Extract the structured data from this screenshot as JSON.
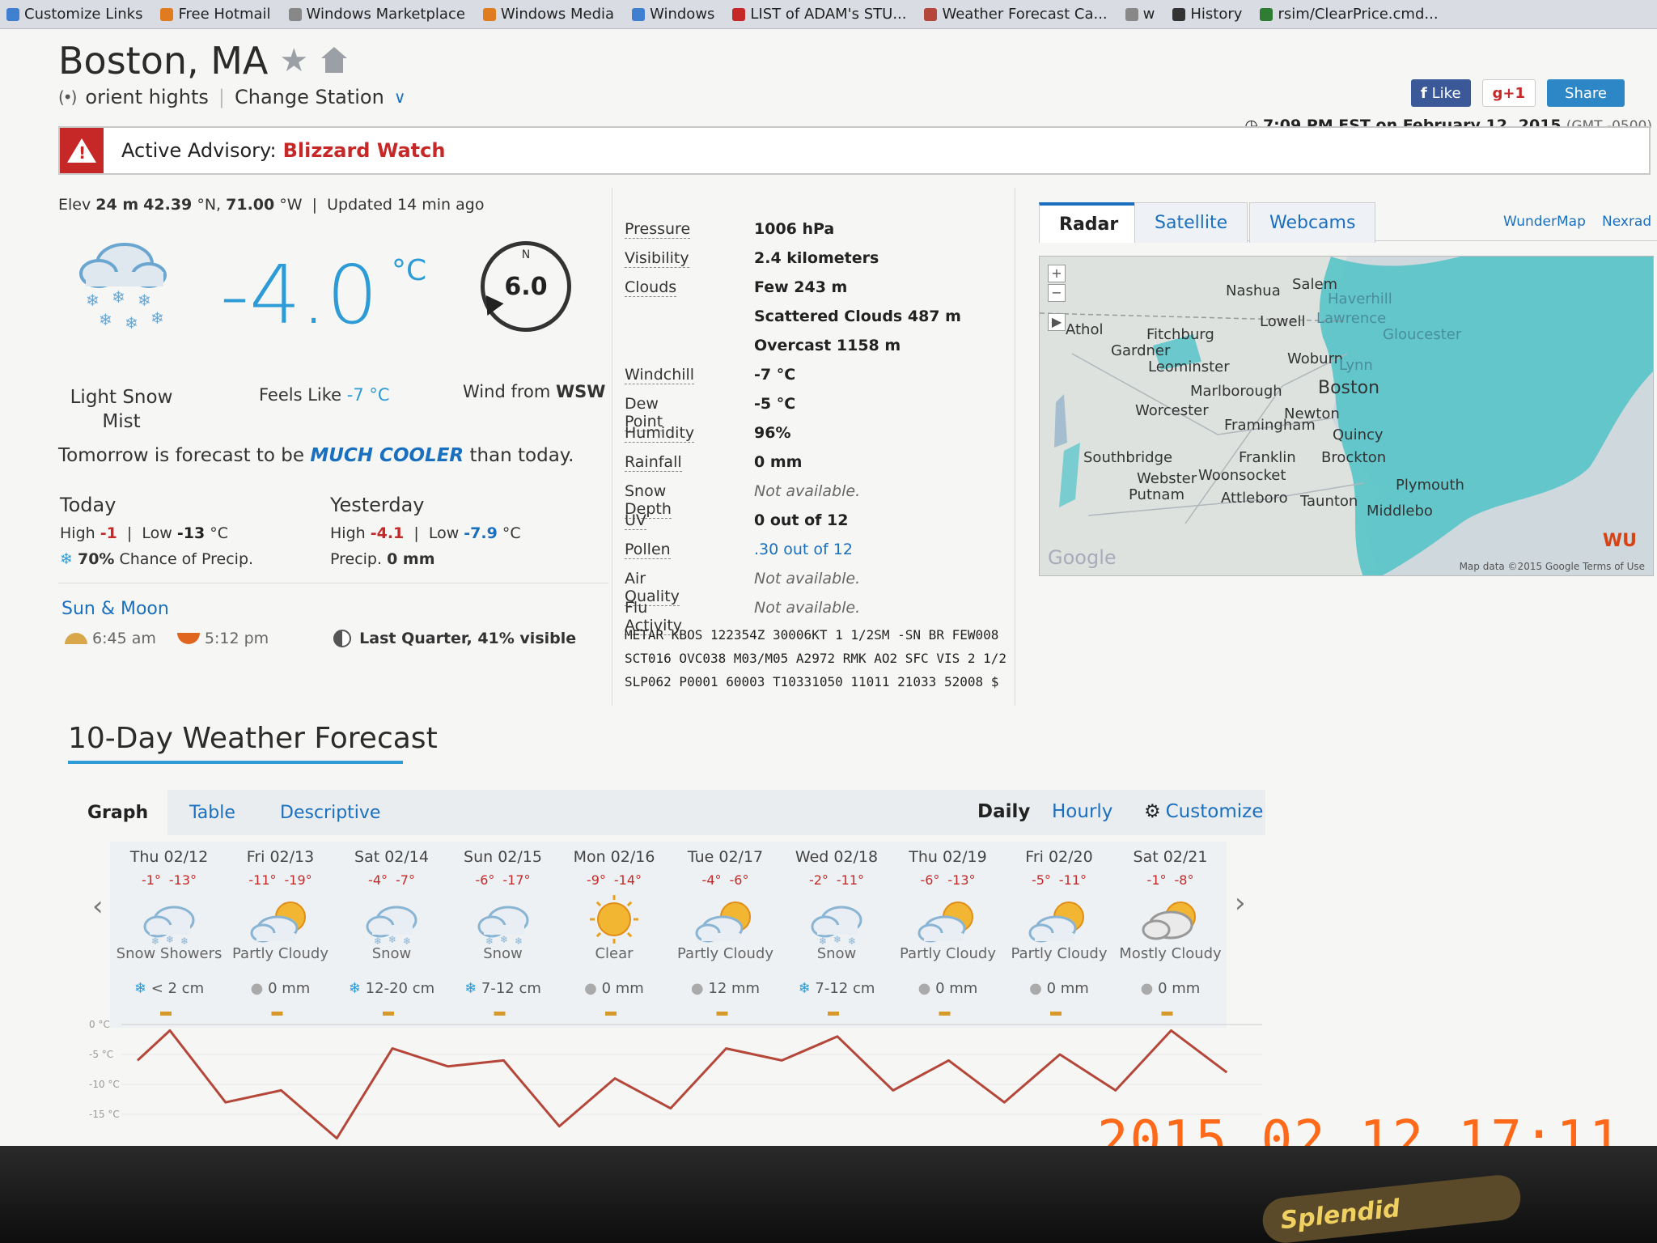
{
  "bookmarks": [
    "Customize Links",
    "Free Hotmail",
    "Windows Marketplace",
    "Windows Media",
    "Windows",
    "LIST of ADAM's STU...",
    "Weather Forecast Ca...",
    "w",
    "History",
    "rsim/ClearPrice.cmd..."
  ],
  "header": {
    "city": "Boston, MA",
    "station": "orient hights",
    "change_station": "Change Station",
    "like": "Like",
    "gplus": "g+1",
    "share": "Share",
    "time": "7:09 PM EST on February 12, 2015",
    "gmt": "(GMT -0500)"
  },
  "advisory": {
    "label": "Active Advisory:",
    "type": "Blizzard Watch"
  },
  "current": {
    "elev_prefix": "Elev",
    "elev": "24 m",
    "lat": "42.39",
    "lon": "71.00",
    "updated": "Updated 14 min ago",
    "temp": "-4.0",
    "unit": "°C",
    "wind_speed": "6.0",
    "wind_n": "N",
    "condition1": "Light Snow",
    "condition2": "Mist",
    "feels_label": "Feels Like",
    "feels": "-7 °C",
    "wind_from_label": "Wind from",
    "wind_dir": "WSW",
    "tomorrow_pre": "Tomorrow is forecast to be",
    "tomorrow_em": "MUCH COOLER",
    "tomorrow_post": "than today."
  },
  "today": {
    "label": "Today",
    "high": "-1",
    "low": "-13",
    "unit": "°C",
    "precip_chance": "70%",
    "precip_text": "Chance of Precip."
  },
  "yesterday": {
    "label": "Yesterday",
    "high": "-4.1",
    "low": "-7.9",
    "unit": "°C",
    "precip_label": "Precip.",
    "precip": "0 mm"
  },
  "sunmoon": {
    "title": "Sun & Moon",
    "sunrise": "6:45 am",
    "sunset": "5:12 pm",
    "phase": "Last Quarter, 41% visible"
  },
  "details": [
    {
      "label": "Pressure",
      "value": "1006 hPa"
    },
    {
      "label": "Visibility",
      "value": "2.4 kilometers"
    },
    {
      "label": "Clouds",
      "value": "Few 243 m"
    },
    {
      "label": "",
      "value": "Scattered Clouds 487 m"
    },
    {
      "label": "",
      "value": "Overcast 1158 m"
    },
    {
      "label": "Windchill",
      "value": "-7 °C"
    },
    {
      "label": "Dew Point",
      "value": "-5 °C"
    },
    {
      "label": "Humidity",
      "value": "96%"
    },
    {
      "label": "Rainfall",
      "value": "0 mm"
    },
    {
      "label": "Snow Depth",
      "value": "Not available."
    },
    {
      "label": "UV",
      "value": "0 out of 12"
    },
    {
      "label": "Pollen",
      "value": ".30 out of 12"
    },
    {
      "label": "Air Quality",
      "value": "Not available."
    },
    {
      "label": "Flu Activity",
      "value": "Not available."
    }
  ],
  "metar": "METAR KBOS 122354Z 30006KT 1 1/2SM -SN BR FEW008 SCT016 OVC038 M03/M05 A2972 RMK AO2 SFC VIS 2 1/2 SLP062 P0001 60003 T10331050 11011 21033 52008 $",
  "map": {
    "tabs": [
      "Radar",
      "Satellite",
      "Webcams"
    ],
    "links": [
      "WunderMap",
      "Nexrad"
    ],
    "cities": [
      "Nashua",
      "Salem",
      "Haverhill",
      "Lawrence",
      "Lowell",
      "Gloucester",
      "Athol",
      "Fitchburg",
      "Gardner",
      "Leominster",
      "Woburn",
      "Lynn",
      "Marlborough",
      "Boston",
      "Worcester",
      "Newton",
      "Framingham",
      "Quincy",
      "Southbridge",
      "Franklin",
      "Brockton",
      "Webster",
      "Woonsocket",
      "Putnam",
      "Attleboro",
      "Taunton",
      "Plymouth",
      "Middlebo"
    ],
    "attrib": "Map data ©2015 Google    Terms of Use",
    "google": "Google",
    "logo": "WU"
  },
  "forecast": {
    "title": "10-Day Weather Forecast",
    "tabs": [
      "Graph",
      "Table",
      "Descriptive"
    ],
    "views": [
      "Daily",
      "Hourly",
      "Customize"
    ],
    "days": [
      {
        "date": "Thu 02/12",
        "hi": "-1°",
        "lo": "-13°",
        "cond": "Snow Showers",
        "precip": "< 2 cm",
        "icon": "snow-icon",
        "snow": true
      },
      {
        "date": "Fri 02/13",
        "hi": "-11°",
        "lo": "-19°",
        "cond": "Partly Cloudy",
        "precip": "0 mm",
        "icon": "partly-cloudy-icon",
        "snow": false
      },
      {
        "date": "Sat 02/14",
        "hi": "-4°",
        "lo": "-7°",
        "cond": "Snow",
        "precip": "12-20 cm",
        "icon": "snow-icon",
        "snow": true
      },
      {
        "date": "Sun 02/15",
        "hi": "-6°",
        "lo": "-17°",
        "cond": "Snow",
        "precip": "7-12 cm",
        "icon": "snow-icon",
        "snow": true
      },
      {
        "date": "Mon 02/16",
        "hi": "-9°",
        "lo": "-14°",
        "cond": "Clear",
        "precip": "0 mm",
        "icon": "sun-icon",
        "snow": false
      },
      {
        "date": "Tue 02/17",
        "hi": "-4°",
        "lo": "-6°",
        "cond": "Partly Cloudy",
        "precip": "12 mm",
        "icon": "partly-cloudy-icon",
        "snow": false
      },
      {
        "date": "Wed 02/18",
        "hi": "-2°",
        "lo": "-11°",
        "cond": "Snow",
        "precip": "7-12 cm",
        "icon": "snow-icon",
        "snow": true
      },
      {
        "date": "Thu 02/19",
        "hi": "-6°",
        "lo": "-13°",
        "cond": "Partly Cloudy",
        "precip": "0 mm",
        "icon": "partly-cloudy-icon",
        "snow": false
      },
      {
        "date": "Fri 02/20",
        "hi": "-5°",
        "lo": "-11°",
        "cond": "Partly Cloudy",
        "precip": "0 mm",
        "icon": "partly-cloudy-icon",
        "snow": false
      },
      {
        "date": "Sat 02/21",
        "hi": "-1°",
        "lo": "-8°",
        "cond": "Mostly Cloudy",
        "precip": "0 mm",
        "icon": "mostly-cloudy-icon",
        "snow": false
      }
    ],
    "yticks": [
      "0 °C",
      "-5 °C",
      "-10 °C",
      "-15 °C"
    ]
  },
  "photo_stamp": "2015.02.12 17:11",
  "colors": {
    "accent": "#1a6fbf",
    "temp": "#2d9bd6",
    "alert": "#c62828",
    "graph_line": "#b5473a",
    "radar": "#4fc3c8"
  }
}
